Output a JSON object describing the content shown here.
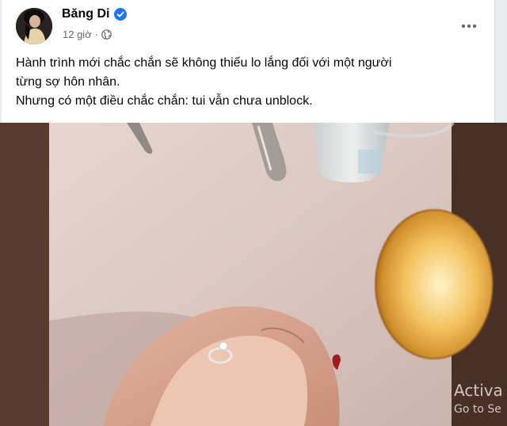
{
  "post": {
    "author": "Băng Di",
    "verified_icon": "verified-badge-icon",
    "time": "12 giờ",
    "separator": "·",
    "audience_icon": "globe-icon",
    "more_icon": "more-options-icon",
    "text_lines": [
      "Hành trình mới chắc chắn sẽ không thiếu lo lắng đối với một người",
      "từng sợ hôn nhân.",
      "Nhưng có một điều chắc chắn: tui vẫn chưa unblock."
    ]
  },
  "colors": {
    "background": "#e9ebee",
    "card": "#ffffff",
    "text": "#050505",
    "secondary_text": "#65676b",
    "verified_blue": "#1877f2"
  },
  "watermark": {
    "line1": "Activa",
    "line2": "Go to Se"
  }
}
